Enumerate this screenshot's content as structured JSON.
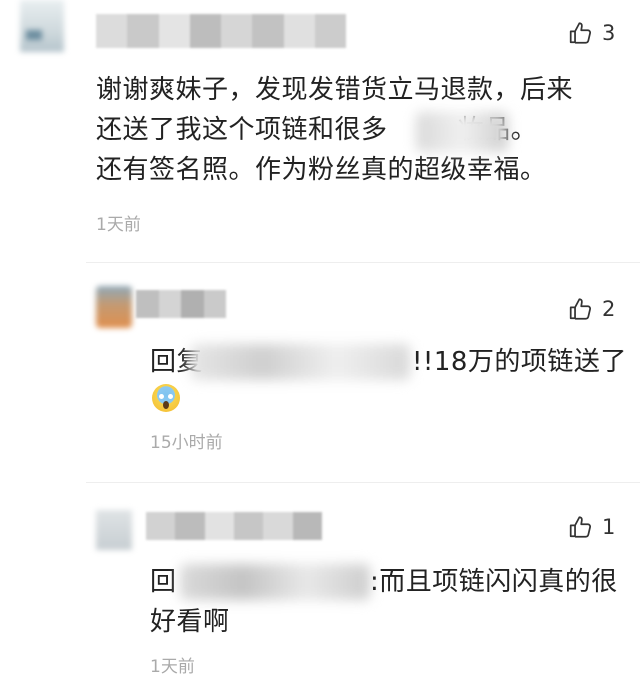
{
  "comments": [
    {
      "likes": "3",
      "body": "谢谢爽妹子，发现发错货立马退款，后来\n还送了我这个项链和很多        妆品。\n还有签名照。作为粉丝真的超级幸福。",
      "time": "1天前"
    },
    {
      "likes": "2",
      "body_prefix": "回复",
      "body": "!!18万的项链送了",
      "emoji": "face-screaming-in-fear",
      "time": "15小时前"
    },
    {
      "likes": "1",
      "body_prefix": "回",
      "body": ":而且项链闪闪真的很\n好看啊",
      "time": "1天前"
    }
  ],
  "icons": {
    "like": "thumbs-up-icon"
  },
  "colors": {
    "text": "#222222",
    "time": "#aaaaaa",
    "divider": "#eeeeee"
  }
}
